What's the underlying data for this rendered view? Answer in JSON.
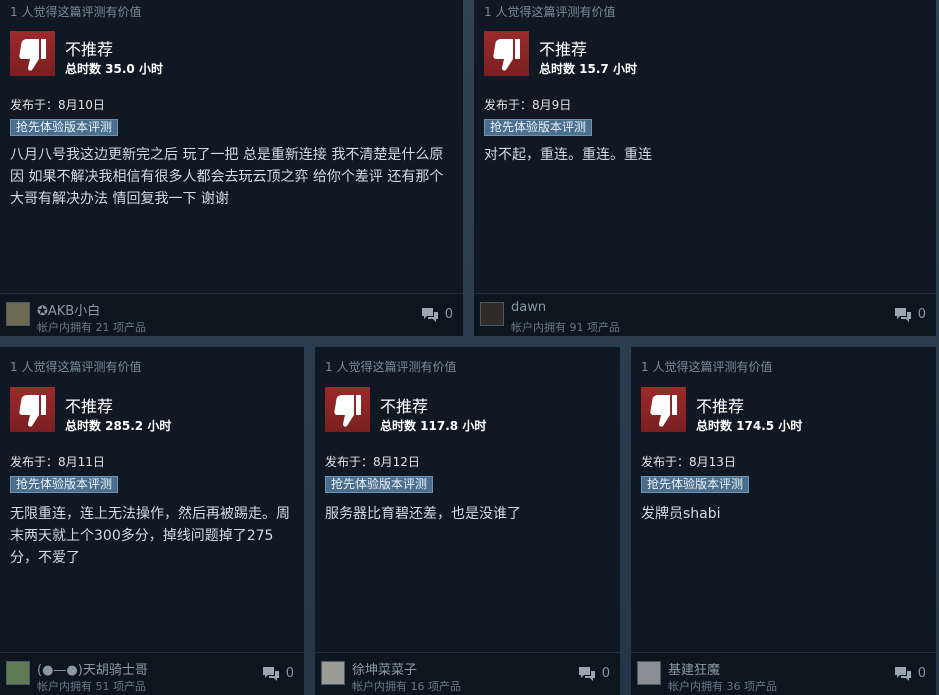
{
  "reviews": [
    {
      "helpful": "1 人觉得这篇评测有价值",
      "recommendation": "不推荐",
      "hours": "总时数 35.0 小时",
      "posted": "发布于：8月10日",
      "badge": "抢先体验版本评测",
      "content": "八月八号我这边更新完之后 玩了一把 总是重新连接 我不清楚是什么原因 如果不解决我相信有很多人都会去玩云顶之弈 给你个差评 还有那个大哥有解决办法 情回复我一下 谢谢",
      "username": "✪AKB小白",
      "owned": "帐户内拥有 21 项产品",
      "comments": "0",
      "avatar_color": "#6b6a50"
    },
    {
      "helpful": "1 人觉得这篇评测有价值",
      "recommendation": "不推荐",
      "hours": "总时数 15.7 小时",
      "posted": "发布于：8月9日",
      "badge": "抢先体验版本评测",
      "content": "对不起，重连。重连。重连",
      "username": "dawn",
      "owned": "帐户内拥有 91 项产品",
      "comments": "0",
      "avatar_color": "#2e2b28"
    },
    {
      "helpful": "1 人觉得这篇评测有价值",
      "recommendation": "不推荐",
      "hours": "总时数 285.2 小时",
      "posted": "发布于：8月11日",
      "badge": "抢先体验版本评测",
      "content": "无限重连，连上无法操作，然后再被踢走。周末两天就上个300多分，掉线问题掉了275分，不爱了",
      "username": "(●—●)天胡骑士哥",
      "owned": "帐户内拥有 51 项产品",
      "comments": "0",
      "avatar_color": "#5f7a55"
    },
    {
      "helpful": "1 人觉得这篇评测有价值",
      "recommendation": "不推荐",
      "hours": "总时数 117.8 小时",
      "posted": "发布于：8月12日",
      "badge": "抢先体验版本评测",
      "content": "服务器比育碧还差，也是没谁了",
      "username": "徐坤菜菜子",
      "owned": "帐户内拥有 16 项产品",
      "comments": "0",
      "avatar_color": "#9a9a96"
    },
    {
      "helpful": "1 人觉得这篇评测有价值",
      "recommendation": "不推荐",
      "hours": "总时数 174.5 小时",
      "posted": "发布于：8月13日",
      "badge": "抢先体验版本评测",
      "content": "发牌员shabi",
      "username": "基建狂魔",
      "owned": "帐户内拥有 36 项产品",
      "comments": "0",
      "avatar_color": "#8a8f94"
    }
  ]
}
